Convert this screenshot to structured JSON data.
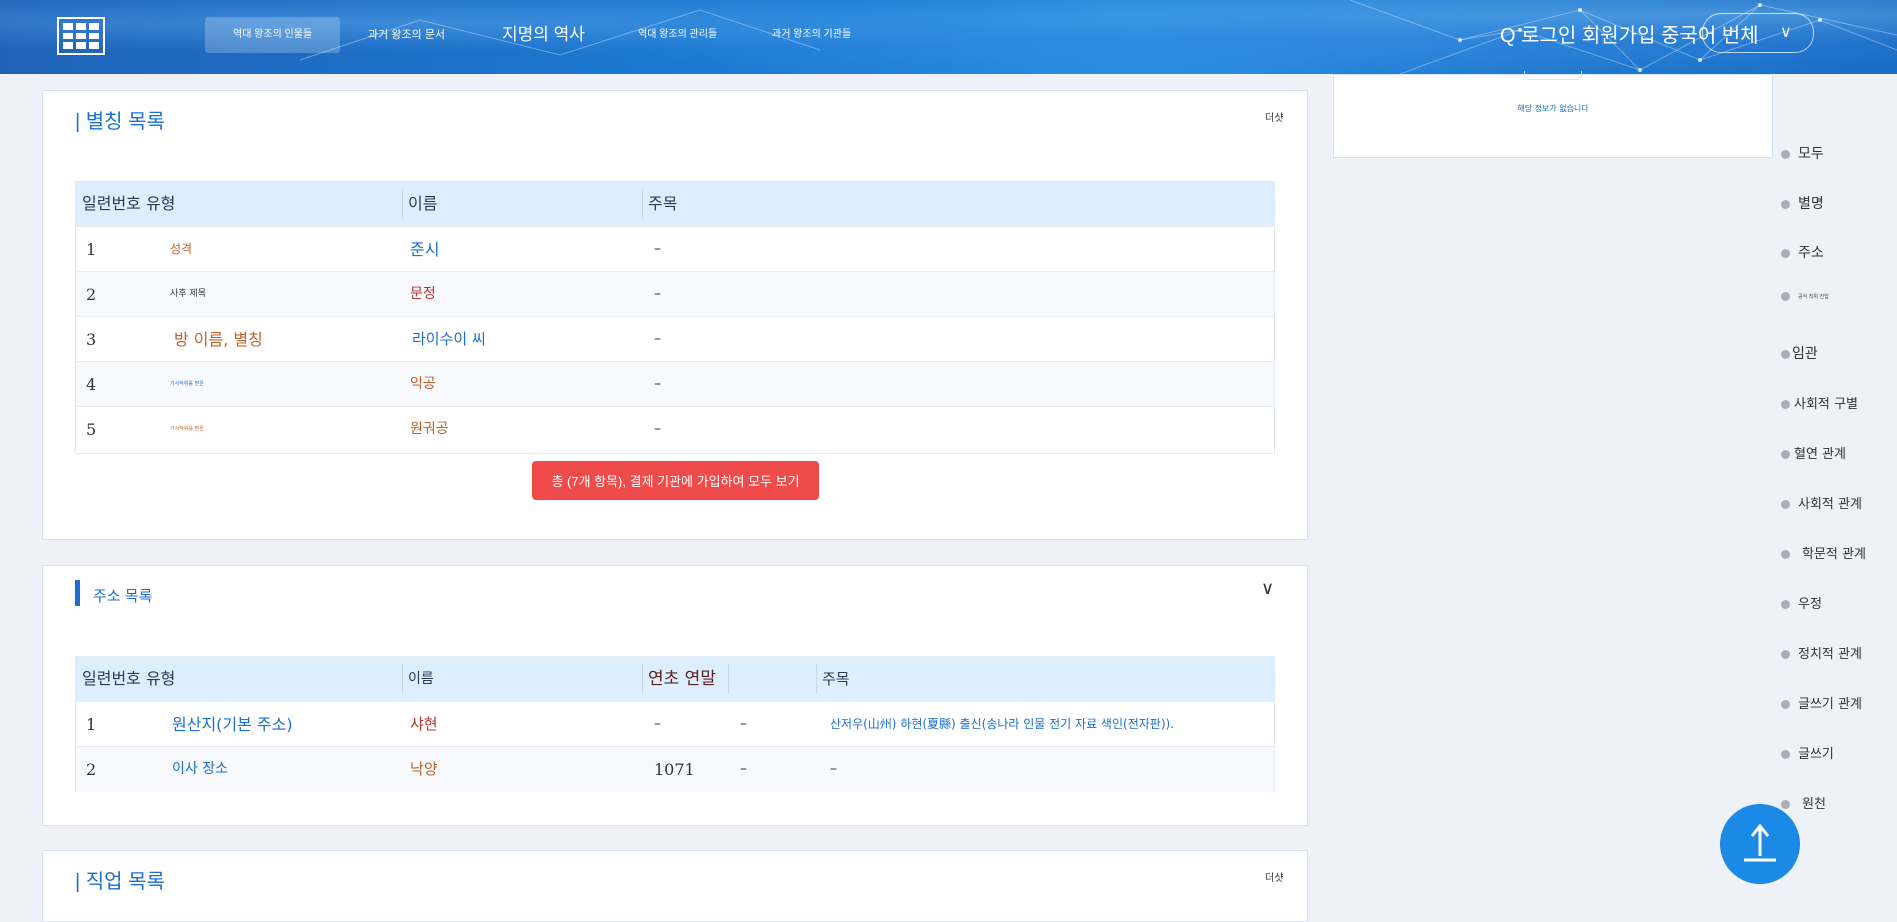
{
  "header": {
    "nav": [
      "역대 왕조의 인물들",
      "과거 왕조의 문서",
      "지명의 역사",
      "역대 왕조의 관리들",
      "과거 왕조의 기관들"
    ],
    "user_bar": "Q 로그인 회원가입 중국어 번체",
    "lang_chevron": "∨"
  },
  "info_box": {
    "message": "해당 정보가 없습니다"
  },
  "alias_section": {
    "title": "| 별칭 목록",
    "more": "더샷",
    "headers": [
      "일련번호 유형",
      "이름",
      "주목"
    ],
    "rows": [
      {
        "no": "1",
        "type": "성격",
        "name": "준시",
        "note": "–"
      },
      {
        "no": "2",
        "type": "사후 제목",
        "name": "문정",
        "note": "–"
      },
      {
        "no": "3",
        "type": "방 이름, 별칭",
        "name": "라이수이 씨",
        "note": "–"
      },
      {
        "no": "4",
        "type": "기사작위를 받은",
        "name": "익공",
        "note": "–"
      },
      {
        "no": "5",
        "type": "기사작위를 받은",
        "name": "원궈공",
        "note": "–"
      }
    ],
    "view_all": "총 (7개 항목), 결제 기관에 가입하여 모두 보기"
  },
  "address_section": {
    "title": "주소 목록",
    "chevron": "∨",
    "headers": [
      "일련번호 유형",
      "이름",
      "연초 연말",
      "주목"
    ],
    "rows": [
      {
        "no": "1",
        "type": "원산지(기본 주소)",
        "name": "샤현",
        "start": "–",
        "end": "–",
        "note": "산저우(山州) 하현(夏縣) 출신(송나라 인물 전기 자료 색인(전자판))."
      },
      {
        "no": "2",
        "type": "이사 장소",
        "name": "낙양",
        "start": "1071",
        "end": "–",
        "note": "–"
      }
    ]
  },
  "job_section": {
    "title": "| 직업 목록",
    "more": "더샷"
  },
  "side_nav": [
    "모두",
    "별명",
    "주소",
    "공식 직위 진입",
    "임관",
    "사회적 구별",
    "혈연 관계",
    "사회적 관계",
    "학문적 관계",
    "우정",
    "정치적 관계",
    "글쓰기 관계",
    "글쓰기",
    "원천"
  ],
  "scroll_top": "↑",
  "colors": {
    "accent_blue": "#1a6fd0",
    "view_all_red": "#f04b4b",
    "type_orange": "#c0622b",
    "name_red": "#b8352f",
    "scroll_btn": "#1a8ae6"
  }
}
